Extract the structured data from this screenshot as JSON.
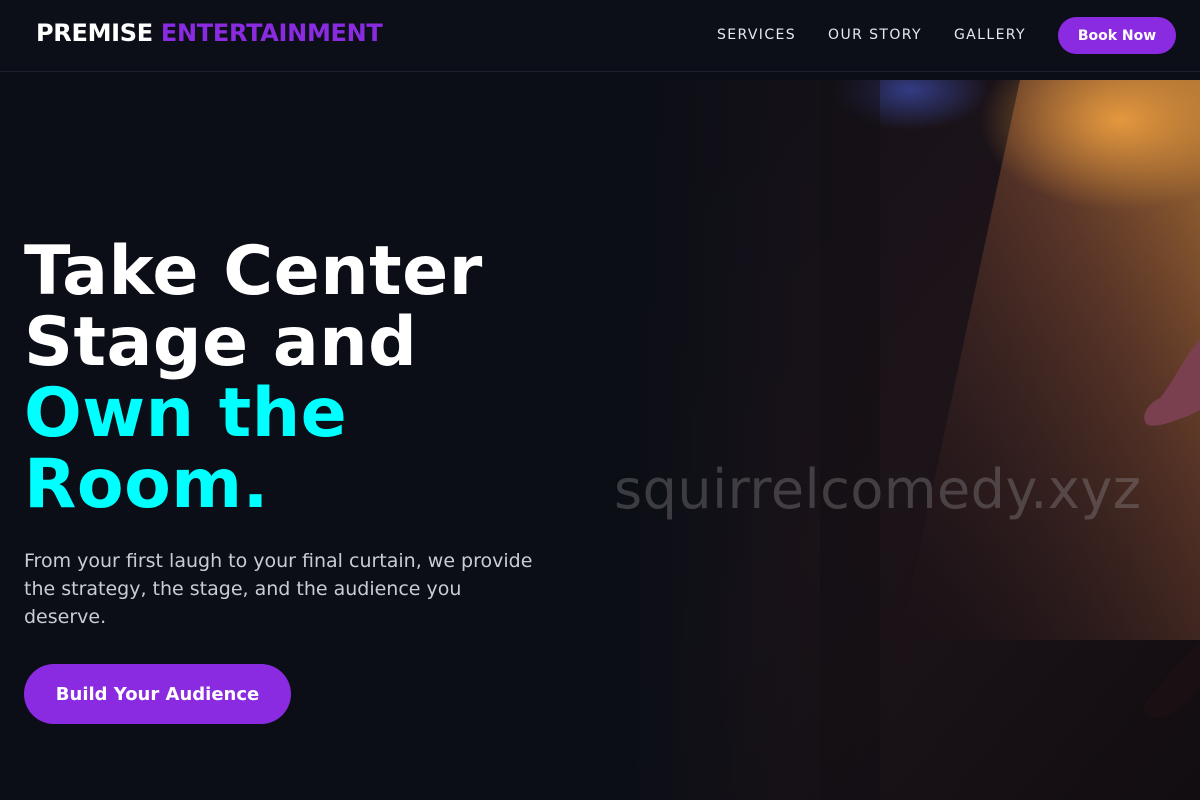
{
  "brand": {
    "name_primary": "PREMISE",
    "name_accent": "ENTERTAINMENT"
  },
  "nav": {
    "links": [
      "SERVICES",
      "OUR STORY",
      "GALLERY"
    ],
    "cta_label": "Book Now"
  },
  "hero": {
    "headline_lines": [
      "Take Center",
      "Stage and"
    ],
    "headline_accent_lines": [
      "Own the",
      "Room."
    ],
    "subtext": "From your first laugh to your final curtain, we provide the strategy, the stage, and the audience you deserve.",
    "cta_label": "Build Your Audience",
    "watermark": "squirrelcomedy.xyz"
  },
  "colors": {
    "background": "#0b0e16",
    "brand_purple": "#8a2be2",
    "accent_cyan": "#00ffff"
  }
}
